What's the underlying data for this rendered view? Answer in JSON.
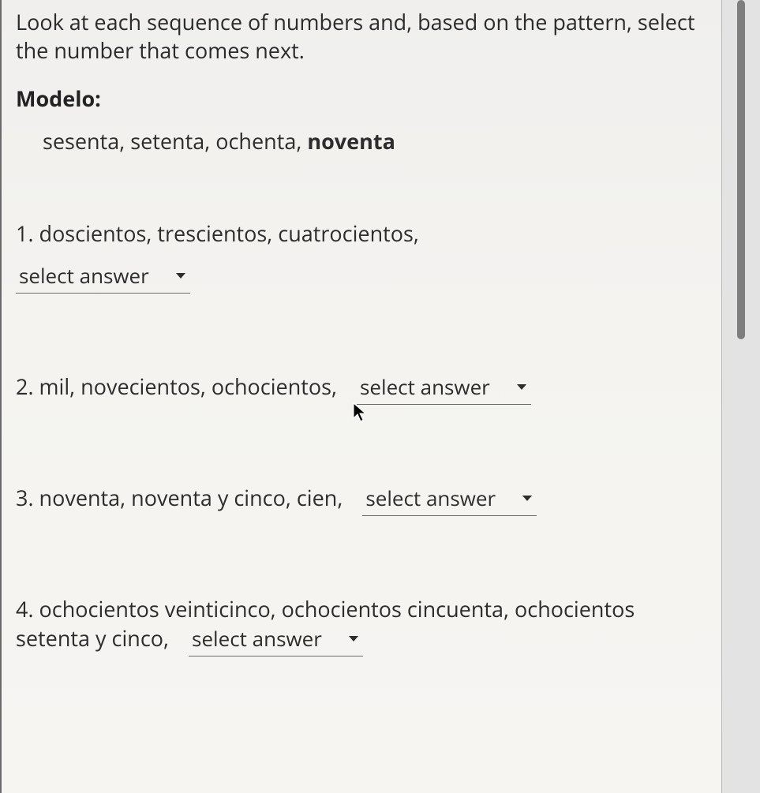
{
  "instructions": "Look at each sequence of numbers and, based on the pattern, select the number that comes next.",
  "modelo": {
    "label": "Modelo:",
    "sequence": "sesenta, setenta, ochenta, ",
    "answer": "noventa"
  },
  "select_placeholder": "select answer",
  "questions": [
    {
      "num": "1.",
      "text": "doscientos, trescientos, cuatrocientos,"
    },
    {
      "num": "2.",
      "text": "mil, novecientos, ochocientos,"
    },
    {
      "num": "3.",
      "text": "noventa, noventa y cinco, cien,"
    },
    {
      "num": "4.",
      "text": "ochocientos veinticinco, ochocientos cincuenta, ochocientos setenta y cinco,"
    }
  ]
}
